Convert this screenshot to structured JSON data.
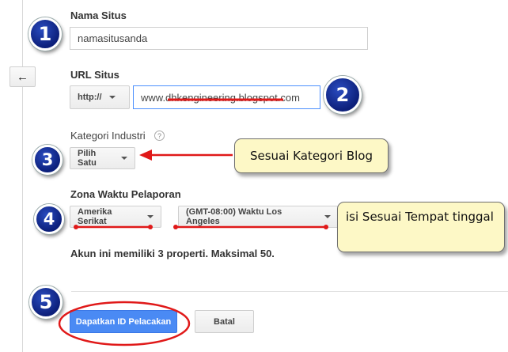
{
  "nav": {
    "back_icon": "←"
  },
  "site_name": {
    "label": "Nama Situs",
    "value": "namasitusanda"
  },
  "site_url": {
    "label": "URL Situs",
    "protocol": "http://",
    "value": "www.dhkengineering.blogspot.com"
  },
  "industry": {
    "label": "Kategori Industri",
    "help": "?",
    "select": "Pilih Satu"
  },
  "timezone": {
    "label": "Zona Waktu Pelaporan",
    "country": "Amerika Serikat",
    "zone": "(GMT-08:00) Waktu Los Angeles"
  },
  "info": "Akun ini memiliki 3 properti. Maksimal 50.",
  "actions": {
    "primary": "Dapatkan ID Pelacakan",
    "cancel": "Batal"
  },
  "annotations": {
    "steps": [
      "1",
      "2",
      "3",
      "4",
      "5"
    ],
    "callout_category": "Sesuai Kategori Blog",
    "callout_timezone": "isi Sesuai Tempat tinggal",
    "colors": {
      "marker": "#e01919",
      "step_circle": "#1a2f9c",
      "callout_bg": "#fdf8c6",
      "primary_button": "#4a8af4"
    }
  }
}
